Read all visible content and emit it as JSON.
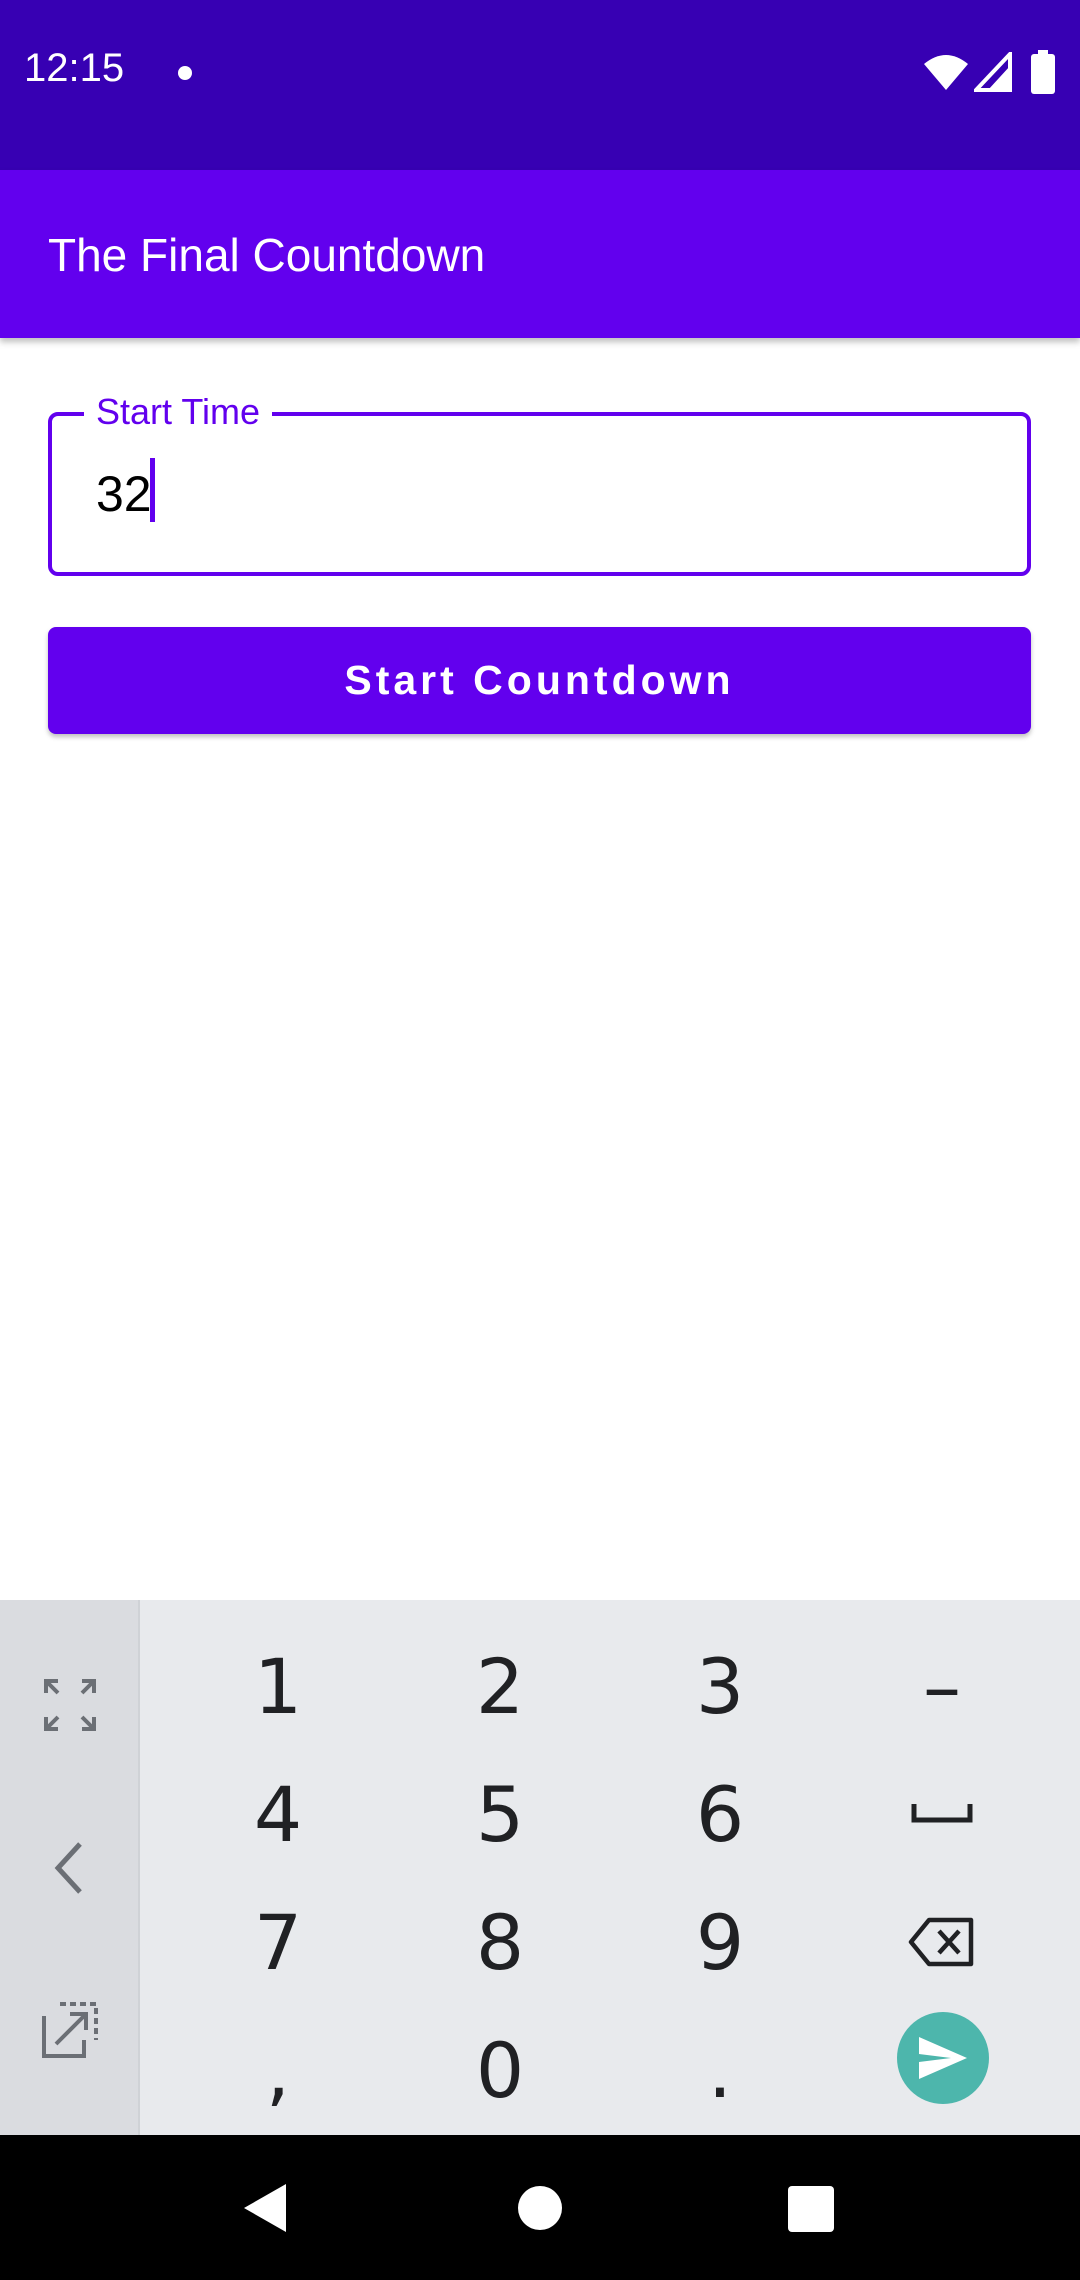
{
  "status_bar": {
    "time": "12:15"
  },
  "app_bar": {
    "title": "The Final Countdown"
  },
  "form": {
    "start_time_label": "Start Time",
    "start_time_value": "32",
    "button_label": "Start Countdown"
  },
  "keyboard": {
    "row1": [
      "1",
      "2",
      "3",
      "–"
    ],
    "row2": [
      "4",
      "5",
      "6"
    ],
    "row3": [
      "7",
      "8",
      "9"
    ],
    "row4": [
      ",",
      "0",
      "."
    ],
    "side_icons": [
      "expand-icon",
      "chevron-left-icon",
      "float-keyboard-icon"
    ],
    "special_icons": [
      "space-icon",
      "backspace-icon",
      "send-icon"
    ]
  },
  "colors": {
    "status_bar": "#3700B3",
    "app_bar": "#6200EE",
    "accent": "#6200EE",
    "send_button": "#4DB6AC",
    "keyboard_bg": "#E8EAED"
  }
}
